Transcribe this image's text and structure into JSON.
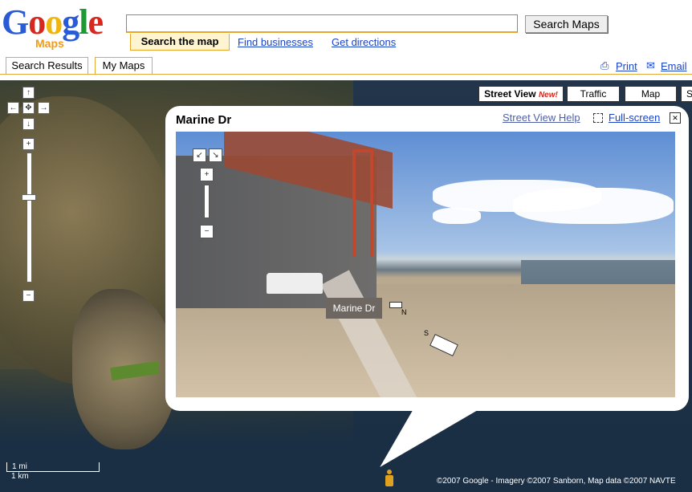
{
  "header": {
    "logo_letters": [
      "G",
      "o",
      "o",
      "g",
      "l",
      "e"
    ],
    "logo_sub": "Maps",
    "search_value": "",
    "search_button": "Search Maps",
    "tab_active": "Search the map",
    "tab_businesses": "Find businesses",
    "tab_directions": "Get directions",
    "search_results": "Search Results",
    "my_maps": "My Maps",
    "print": "Print",
    "email": "Email"
  },
  "map_controls": {
    "pan_up": "↑",
    "pan_left": "←",
    "pan_center": "✥",
    "pan_right": "→",
    "pan_down": "↓",
    "zoom_in": "+",
    "zoom_out": "−"
  },
  "map_types": {
    "street_view": "Street View",
    "street_view_new": "New!",
    "traffic": "Traffic",
    "map": "Map",
    "satellite": "S"
  },
  "bubble": {
    "title": "Marine Dr",
    "help_link": "Street View Help",
    "fullscreen": "Full-screen",
    "close": "✕",
    "sv_label": "Marine Dr",
    "compass_n": "N",
    "compass_s": "S",
    "sv_zoom_in": "+",
    "sv_zoom_out": "−",
    "sv_pan_left": "↙",
    "sv_pan_right": "↘"
  },
  "scale": {
    "miles": "1 mi",
    "km": "1 km"
  },
  "copyright": "©2007 Google - Imagery ©2007 Sanborn, Map data ©2007 NAVTE",
  "colors": {
    "accent_orange": "#e3a93b",
    "link_blue": "#1a44c8",
    "new_red": "#d6281f"
  }
}
